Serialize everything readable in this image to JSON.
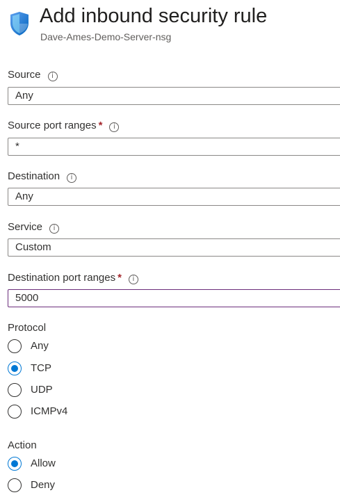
{
  "header": {
    "title": "Add inbound security rule",
    "subtitle": "Dave-Ames-Demo-Server-nsg",
    "icon": "shield-icon"
  },
  "fields": {
    "source": {
      "label": "Source",
      "value": "Any"
    },
    "source_port_ranges": {
      "label": "Source port ranges",
      "required": "*",
      "value": "*"
    },
    "destination": {
      "label": "Destination",
      "value": "Any"
    },
    "service": {
      "label": "Service",
      "value": "Custom"
    },
    "destination_port_ranges": {
      "label": "Destination port ranges",
      "required": "*",
      "value": "5000"
    }
  },
  "protocol": {
    "label": "Protocol",
    "options": [
      "Any",
      "TCP",
      "UDP",
      "ICMPv4"
    ],
    "selected": "TCP"
  },
  "action": {
    "label": "Action",
    "options": [
      "Allow",
      "Deny"
    ],
    "selected": "Allow"
  },
  "colors": {
    "accent": "#0078d4",
    "required": "#a4262c",
    "focus_border": "#6b2d7b"
  },
  "info_glyph": "i"
}
